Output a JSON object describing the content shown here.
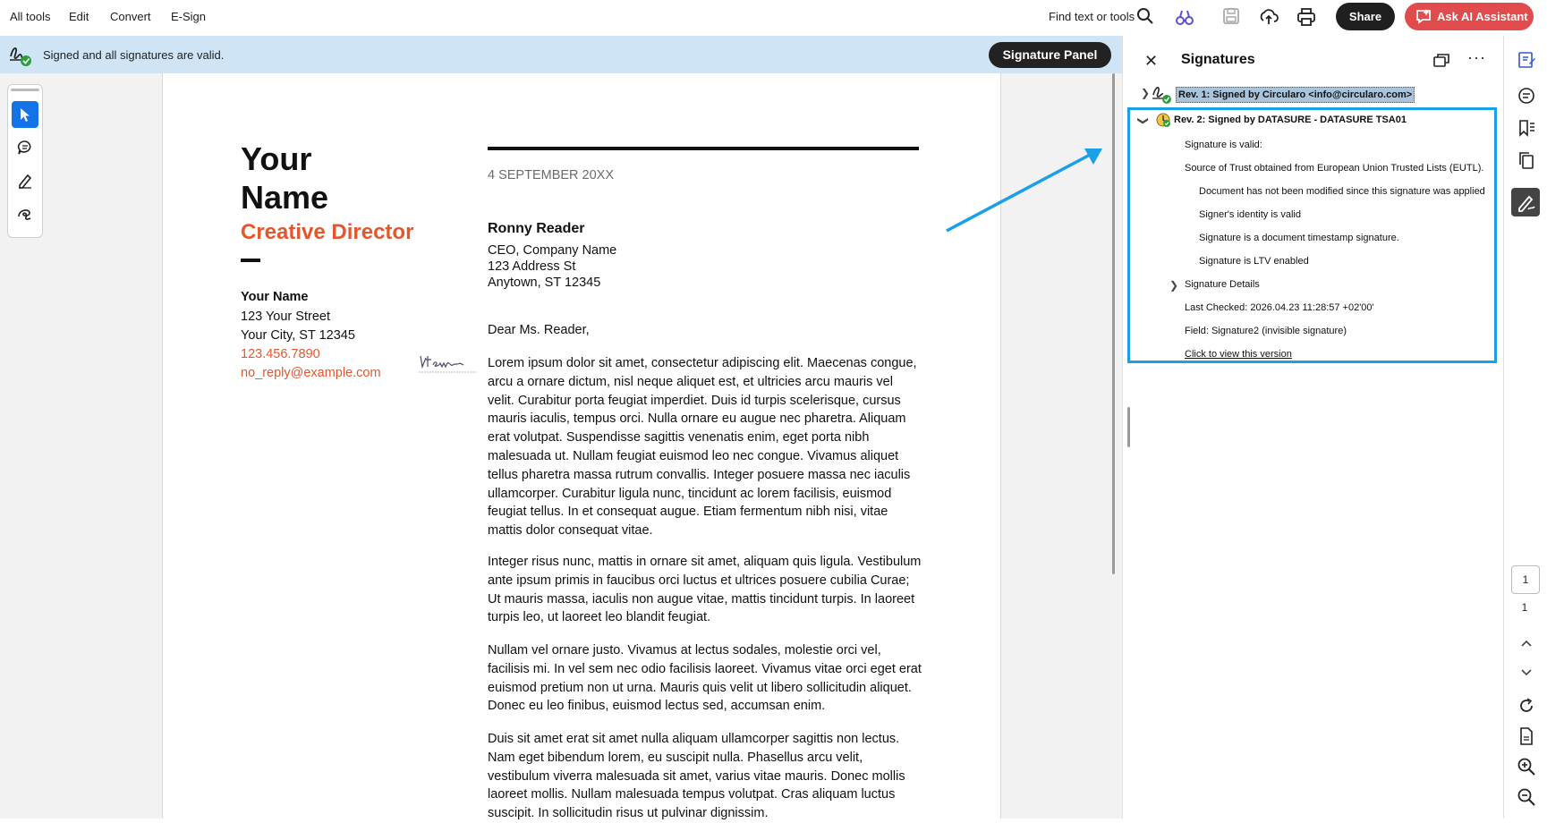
{
  "menu": {
    "items": [
      "All tools",
      "Edit",
      "Convert",
      "E-Sign"
    ]
  },
  "toolbar": {
    "find_label": "Find text or tools",
    "share_label": "Share",
    "ai_label": "Ask AI Assistant",
    "icons": [
      "search-icon",
      "ai-tools-icon",
      "save-icon",
      "upload-icon",
      "print-icon"
    ]
  },
  "banner": {
    "text": "Signed and all signatures are valid.",
    "button_label": "Signature Panel"
  },
  "document": {
    "name_line1": "Your",
    "name_line2": "Name",
    "title": "Creative Director",
    "contact": {
      "name": "Your Name",
      "street": "123 Your Street",
      "city": "Your City, ST 12345",
      "phone": "123.456.7890",
      "email": "no_reply@example.com"
    },
    "date": "4 SEPTEMBER 20XX",
    "recipient": {
      "name": "Ronny Reader",
      "title": "CEO, Company Name",
      "street": "123 Address St",
      "city": "Anytown, ST 12345"
    },
    "salutation": "Dear Ms. Reader,",
    "paragraphs": [
      "Lorem ipsum dolor sit amet, consectetur adipiscing elit. Maecenas congue, arcu a ornare dictum, nisl neque aliquet est, et ultricies arcu mauris vel velit. Curabitur porta feugiat imperdiet. Duis id turpis scelerisque, cursus mauris iaculis, tempus orci. Nulla ornare eu augue nec pharetra. Aliquam erat volutpat. Suspendisse sagittis venenatis enim, eget porta nibh malesuada ut. Nullam feugiat euismod leo nec congue. Vivamus aliquet tellus pharetra massa rutrum convallis. Integer posuere massa nec iaculis ullamcorper. Curabitur ligula nunc, tincidunt ac lorem facilisis, euismod feugiat tellus. In et consequat augue. Etiam fermentum nibh nisi, vitae mattis dolor consequat vitae.",
      "Integer risus nunc, mattis in ornare sit amet, aliquam quis ligula. Vestibulum ante ipsum primis in faucibus orci luctus et ultrices posuere cubilia Curae; Ut mauris massa, iaculis non augue vitae, mattis tincidunt turpis. In laoreet turpis leo, ut laoreet leo blandit feugiat.",
      "Nullam vel ornare justo. Vivamus at lectus sodales, molestie orci vel, facilisis mi. In vel sem nec odio facilisis laoreet. Vivamus vitae orci eget erat euismod pretium non ut urna. Mauris quis velit ut libero sollicitudin aliquet. Donec eu leo finibus, euismod lectus sed, accumsan enim.",
      "Duis sit amet erat sit amet nulla aliquam ullamcorper sagittis non lectus. Nam eget bibendum lorem, eu suscipit nulla. Phasellus arcu velit, vestibulum viverra malesuada sit amet, varius vitae mauris. Donec mollis laoreet mollis. Nullam malesuada tempus volutpat. Cras aliquam luctus suscipit. In sollicitudin risus ut pulvinar dignissim."
    ]
  },
  "signatures_panel": {
    "title": "Signatures",
    "rev1": "Rev. 1: Signed by Circularo <info@circularo.com>",
    "rev2": "Rev. 2: Signed by DATASURE - DATASURE TSA01",
    "details": {
      "valid": "Signature is valid:",
      "trust_source": "Source of Trust obtained from European Union Trusted Lists (EUTL).",
      "not_modified": "Document has not been modified since this signature was applied",
      "identity_valid": "Signer's identity is valid",
      "timestamp": "Signature is a document timestamp signature.",
      "ltv": "Signature is LTV enabled",
      "details_label": "Signature Details",
      "last_checked": "Last Checked: 2026.04.23 11:28:57 +02'00'",
      "field": "Field: Signature2 (invisible signature)",
      "view_version": "Click to view this version"
    }
  },
  "pagination": {
    "current": "1",
    "total": "1"
  },
  "colors": {
    "accent_blue": "#1473e6",
    "highlight_box": "#1aa0e8",
    "brand_red": "#e4572e",
    "banner_bg": "#cfe5f5",
    "ai_button": "#e24b4b"
  }
}
